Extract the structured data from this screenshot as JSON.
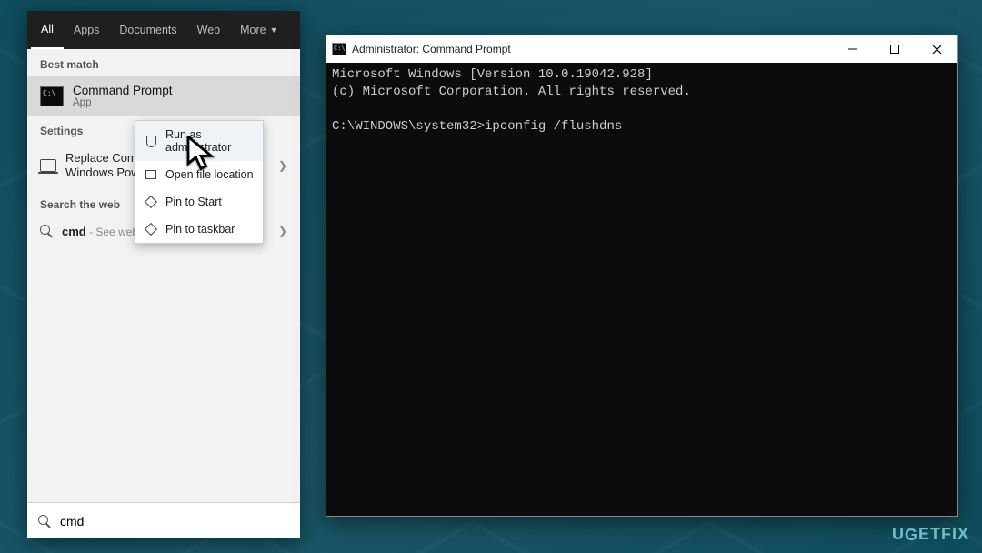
{
  "search": {
    "tabs": {
      "all": "All",
      "apps": "Apps",
      "documents": "Documents",
      "web": "Web",
      "more": "More"
    },
    "best_match_label": "Best match",
    "best_match": {
      "title": "Command Prompt",
      "subtitle": "App"
    },
    "settings_label": "Settings",
    "settings_item_line1": "Replace Com",
    "settings_item_line2": "Windows Pow",
    "web_label": "Search the web",
    "web_query": "cmd",
    "web_hint": " - See web results",
    "input_value": "cmd"
  },
  "context_menu": {
    "run_admin": "Run as administrator",
    "open_location": "Open file location",
    "pin_start": "Pin to Start",
    "pin_taskbar": "Pin to taskbar"
  },
  "cmd": {
    "title": "Administrator: Command Prompt",
    "line1": "Microsoft Windows [Version 10.0.19042.928]",
    "line2": "(c) Microsoft Corporation. All rights reserved.",
    "prompt": "C:\\WINDOWS\\system32>",
    "command": "ipconfig /flushdns"
  },
  "watermark": "UGETFIX"
}
